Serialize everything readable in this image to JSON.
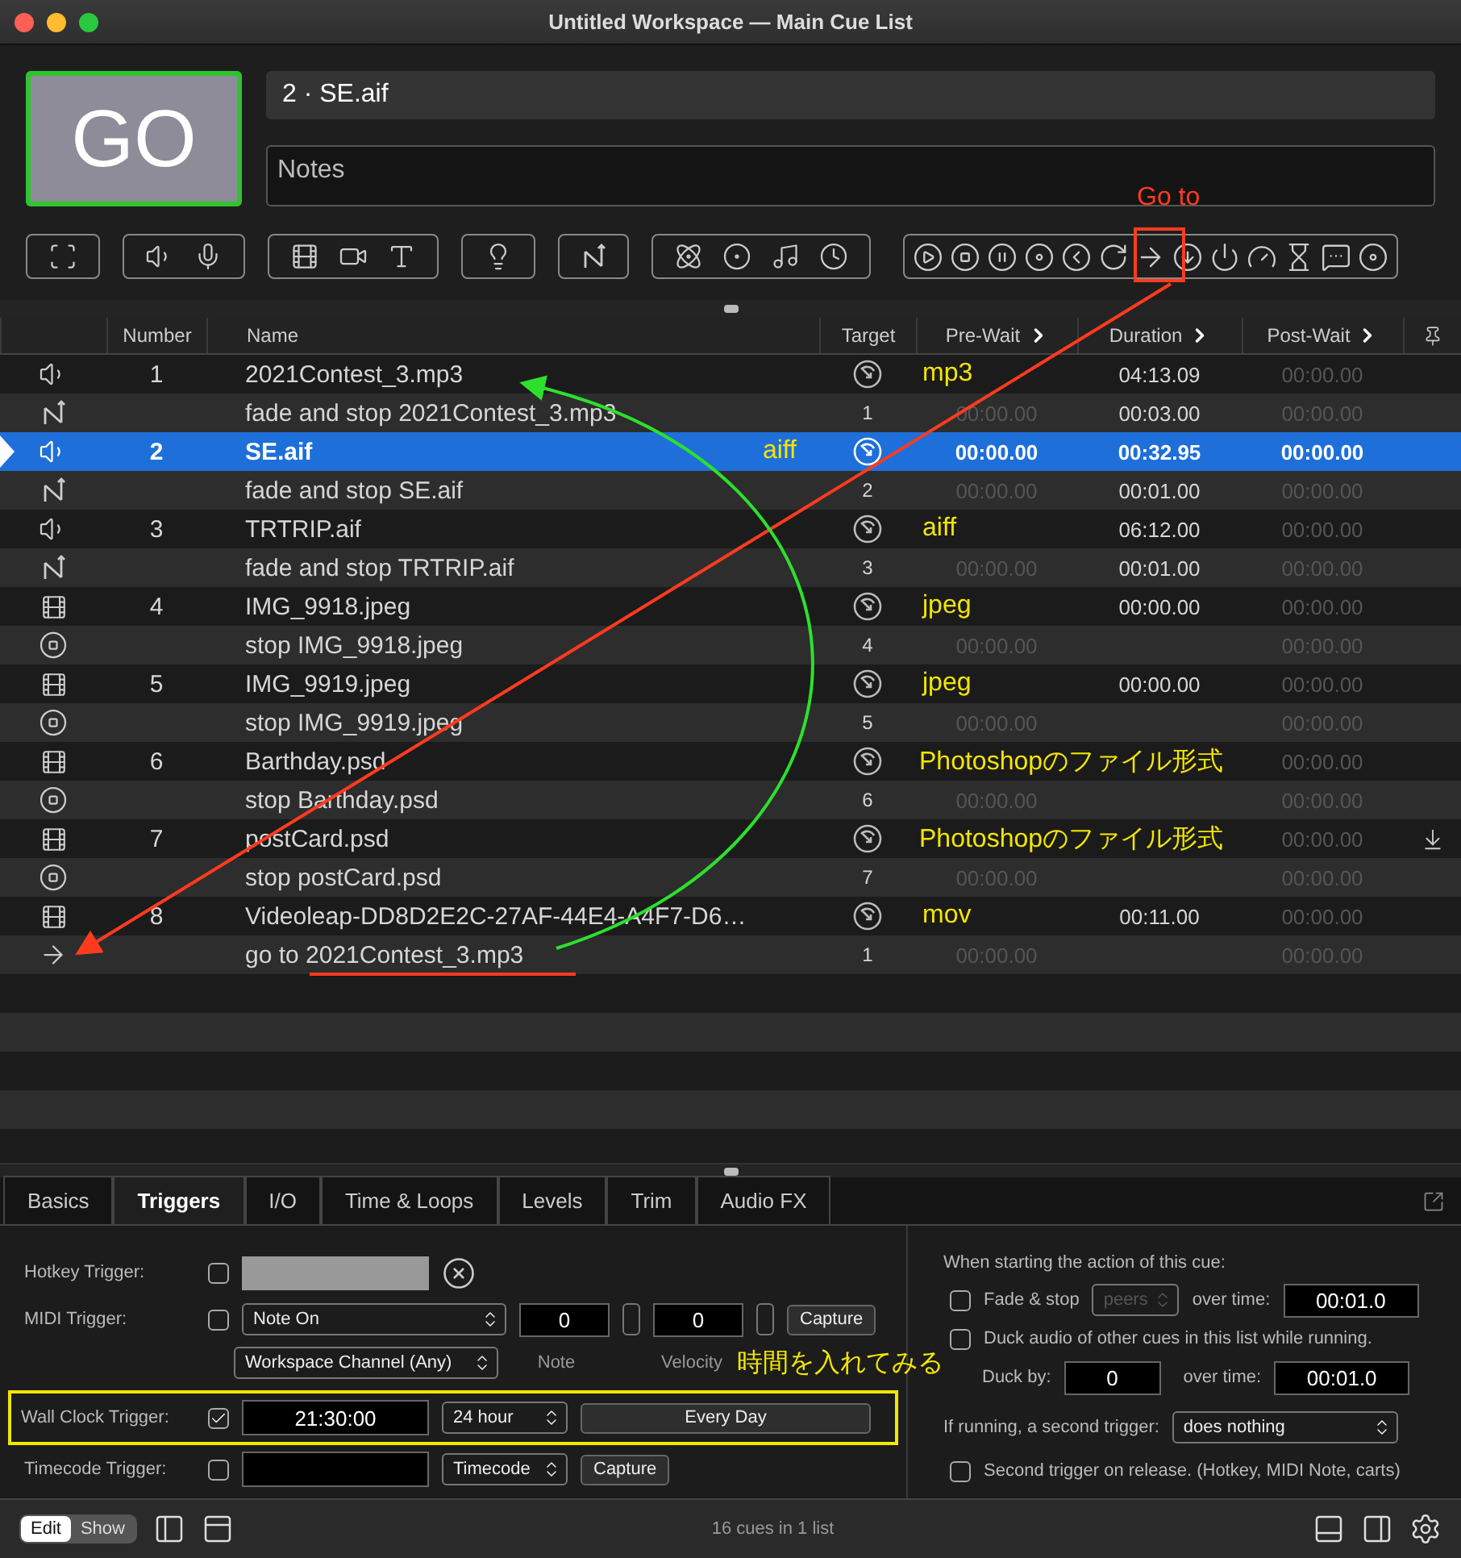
{
  "window": {
    "title": "Untitled Workspace — Main Cue List"
  },
  "go_button": {
    "label": "GO"
  },
  "cue_name": {
    "value": "2 · SE.aif"
  },
  "notes": {
    "placeholder": "Notes"
  },
  "table": {
    "columns": [
      "Number",
      "Name",
      "Target",
      "Pre-Wait",
      "Duration",
      "Post-Wait"
    ],
    "rows": [
      {
        "kind": "audio",
        "number": "1",
        "name": "2021Contest_3.mp3",
        "target": {
          "kind": "icon"
        },
        "duration": "04:13.09",
        "post_wait": "00:00.00",
        "note": {
          "kind": "prewait",
          "text": "mp3"
        },
        "selected": false,
        "continue": false
      },
      {
        "kind": "fade",
        "name": "fade and stop 2021Contest_3.mp3",
        "target": {
          "kind": "text",
          "text": "1"
        },
        "pre_wait": "00:00.00",
        "duration": "00:03.00",
        "post_wait": "00:00.00",
        "selected": false,
        "continue": false
      },
      {
        "kind": "audio",
        "number": "2",
        "name": "SE.aif",
        "target": {
          "kind": "icon"
        },
        "pre_wait": "00:00.00",
        "duration": "00:32.95",
        "post_wait": "00:00.00",
        "note": {
          "kind": "name",
          "text": "aiff"
        },
        "selected": true,
        "continue": false
      },
      {
        "kind": "fade",
        "name": "fade and stop SE.aif",
        "target": {
          "kind": "text",
          "text": "2"
        },
        "pre_wait": "00:00.00",
        "duration": "00:01.00",
        "post_wait": "00:00.00",
        "selected": false,
        "continue": false
      },
      {
        "kind": "audio",
        "number": "3",
        "name": "TRTRIP.aif",
        "target": {
          "kind": "icon"
        },
        "duration": "06:12.00",
        "post_wait": "00:00.00",
        "note": {
          "kind": "prewait",
          "text": "aiff"
        },
        "selected": false,
        "continue": false
      },
      {
        "kind": "fade",
        "name": "fade and stop TRTRIP.aif",
        "target": {
          "kind": "text",
          "text": "3"
        },
        "pre_wait": "00:00.00",
        "duration": "00:01.00",
        "post_wait": "00:00.00",
        "selected": false,
        "continue": false
      },
      {
        "kind": "video",
        "number": "4",
        "name": "IMG_9918.jpeg",
        "target": {
          "kind": "icon"
        },
        "duration": "00:00.00",
        "post_wait": "00:00.00",
        "note": {
          "kind": "prewait",
          "text": "jpeg"
        },
        "selected": false,
        "continue": false
      },
      {
        "kind": "stop",
        "name": "stop IMG_9918.jpeg",
        "target": {
          "kind": "text",
          "text": "4"
        },
        "pre_wait": "00:00.00",
        "post_wait": "00:00.00",
        "selected": false,
        "continue": false
      },
      {
        "kind": "video",
        "number": "5",
        "name": "IMG_9919.jpeg",
        "target": {
          "kind": "icon"
        },
        "duration": "00:00.00",
        "post_wait": "00:00.00",
        "note": {
          "kind": "prewait",
          "text": "jpeg"
        },
        "selected": false,
        "continue": false
      },
      {
        "kind": "stop",
        "name": "stop IMG_9919.jpeg",
        "target": {
          "kind": "text",
          "text": "5"
        },
        "pre_wait": "00:00.00",
        "post_wait": "00:00.00",
        "selected": false,
        "continue": false
      },
      {
        "kind": "video",
        "number": "6",
        "name": "Barthday.psd",
        "target": {
          "kind": "icon"
        },
        "post_wait": "00:00.00",
        "note": {
          "kind": "wide",
          "text": "Photoshopのファイル形式"
        },
        "selected": false,
        "continue": false
      },
      {
        "kind": "stop",
        "name": "stop Barthday.psd",
        "target": {
          "kind": "text",
          "text": "6"
        },
        "pre_wait": "00:00.00",
        "post_wait": "00:00.00",
        "selected": false,
        "continue": false
      },
      {
        "kind": "video",
        "number": "7",
        "name": "postCard.psd",
        "target": {
          "kind": "icon"
        },
        "post_wait": "00:00.00",
        "note": {
          "kind": "wide",
          "text": "Photoshopのファイル形式"
        },
        "selected": false,
        "continue": true
      },
      {
        "kind": "stop",
        "name": "stop postCard.psd",
        "target": {
          "kind": "text",
          "text": "7"
        },
        "pre_wait": "00:00.00",
        "post_wait": "00:00.00",
        "selected": false,
        "continue": false
      },
      {
        "kind": "video",
        "number": "8",
        "name": "Videoleap-DD8D2E2C-27AF-44E4-A4F7-D6…",
        "target": {
          "kind": "icon"
        },
        "duration": "00:11.00",
        "post_wait": "00:00.00",
        "note": {
          "kind": "prewait",
          "text": "mov"
        },
        "selected": false,
        "continue": false
      },
      {
        "kind": "goto",
        "name": "go to 2021Contest_3.mp3",
        "target": {
          "kind": "text",
          "text": "1"
        },
        "pre_wait": "00:00.00",
        "post_wait": "00:00.00",
        "selected": false,
        "continue": false
      }
    ]
  },
  "inspector": {
    "tabs": [
      {
        "label": "Basics",
        "selected": false
      },
      {
        "label": "Triggers",
        "selected": true
      },
      {
        "label": "I/O",
        "selected": false
      },
      {
        "label": "Time & Loops",
        "selected": false
      },
      {
        "label": "Levels",
        "selected": false
      },
      {
        "label": "Trim",
        "selected": false
      },
      {
        "label": "Audio FX",
        "selected": false
      }
    ],
    "hotkey": {
      "label": "Hotkey Trigger:",
      "checked": false
    },
    "midi": {
      "label": "MIDI Trigger:",
      "checked": false,
      "message": "Note On",
      "note": "0",
      "velocity": "0",
      "capture": "Capture",
      "channel": "Workspace Channel (Any)",
      "note_label": "Note",
      "velocity_label": "Velocity"
    },
    "wall_clock": {
      "label": "Wall Clock Trigger:",
      "checked": true,
      "highlighted": true,
      "time": "21:30:00",
      "format": "24 hour",
      "days": "Every Day"
    },
    "timecode": {
      "label": "Timecode Trigger:",
      "checked": false,
      "format": "Timecode",
      "capture": "Capture"
    },
    "start_heading": "When starting the action of this cue:",
    "fade_stop": {
      "label": "Fade & stop",
      "checked": false,
      "scope": "peers",
      "scope_disabled": true,
      "over_label": "over time:",
      "time": "00:01.0"
    },
    "duck": {
      "label": "Duck audio of other cues in this list while running.",
      "checked": false,
      "by_label": "Duck by:",
      "by": "0",
      "over_label": "over time:",
      "time": "00:01.0"
    },
    "second_trigger": {
      "label": "If running, a second trigger:",
      "value": "does nothing"
    },
    "release": {
      "label": "Second trigger on release. (Hotkey, MIDI Note, carts)",
      "checked": false
    }
  },
  "footer": {
    "modes": [
      {
        "label": "Edit",
        "selected": true
      },
      {
        "label": "Show",
        "selected": false
      }
    ],
    "status": "16 cues in 1 list"
  },
  "annotations": {
    "goto_label": "Go to",
    "wall_clock_note": "時間を入れてみる"
  }
}
